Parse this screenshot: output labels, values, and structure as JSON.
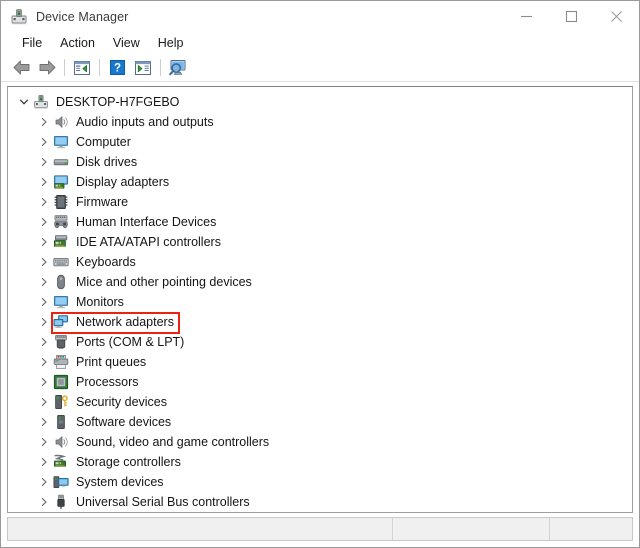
{
  "window": {
    "title": "Device Manager",
    "icon": "device-manager-icon",
    "controls": {
      "minimize": "Minimize",
      "maximize": "Maximize",
      "close": "Close"
    }
  },
  "menubar": {
    "items": [
      {
        "label": "File"
      },
      {
        "label": "Action"
      },
      {
        "label": "View"
      },
      {
        "label": "Help"
      }
    ]
  },
  "toolbar": {
    "buttons": [
      {
        "name": "back-arrow-icon",
        "tooltip": "Back"
      },
      {
        "name": "forward-arrow-icon",
        "tooltip": "Forward"
      },
      {
        "name": "show-hide-console-tree-icon",
        "tooltip": "Show/Hide Console Tree"
      },
      {
        "name": "help-icon",
        "tooltip": "Help"
      },
      {
        "name": "properties-icon",
        "tooltip": "Properties"
      },
      {
        "name": "scan-for-hardware-changes-icon",
        "tooltip": "Scan for hardware changes"
      }
    ]
  },
  "tree": {
    "root": {
      "label": "DESKTOP-H7FGEBO",
      "icon": "computer-device-icon",
      "expanded": true
    },
    "items": [
      {
        "label": "Audio inputs and outputs",
        "icon": "speaker-icon",
        "expanded": false,
        "highlighted": false
      },
      {
        "label": "Computer",
        "icon": "monitor-icon",
        "expanded": false,
        "highlighted": false
      },
      {
        "label": "Disk drives",
        "icon": "disk-drive-icon",
        "expanded": false,
        "highlighted": false
      },
      {
        "label": "Display adapters",
        "icon": "display-adapter-icon",
        "expanded": false,
        "highlighted": false
      },
      {
        "label": "Firmware",
        "icon": "firmware-chip-icon",
        "expanded": false,
        "highlighted": false
      },
      {
        "label": "Human Interface Devices",
        "icon": "gamepad-icon",
        "expanded": false,
        "highlighted": false
      },
      {
        "label": "IDE ATA/ATAPI controllers",
        "icon": "ide-controller-icon",
        "expanded": false,
        "highlighted": false
      },
      {
        "label": "Keyboards",
        "icon": "keyboard-icon",
        "expanded": false,
        "highlighted": false
      },
      {
        "label": "Mice and other pointing devices",
        "icon": "mouse-icon",
        "expanded": false,
        "highlighted": false
      },
      {
        "label": "Monitors",
        "icon": "monitor-icon",
        "expanded": false,
        "highlighted": false
      },
      {
        "label": "Network adapters",
        "icon": "network-adapter-icon",
        "expanded": false,
        "highlighted": true
      },
      {
        "label": "Ports (COM & LPT)",
        "icon": "port-connector-icon",
        "expanded": false,
        "highlighted": false
      },
      {
        "label": "Print queues",
        "icon": "printer-icon",
        "expanded": false,
        "highlighted": false
      },
      {
        "label": "Processors",
        "icon": "processor-chip-icon",
        "expanded": false,
        "highlighted": false
      },
      {
        "label": "Security devices",
        "icon": "security-key-icon",
        "expanded": false,
        "highlighted": false
      },
      {
        "label": "Software devices",
        "icon": "software-device-icon",
        "expanded": false,
        "highlighted": false
      },
      {
        "label": "Sound, video and game controllers",
        "icon": "speaker-icon",
        "expanded": false,
        "highlighted": false
      },
      {
        "label": "Storage controllers",
        "icon": "storage-controller-icon",
        "expanded": false,
        "highlighted": false
      },
      {
        "label": "System devices",
        "icon": "system-device-icon",
        "expanded": false,
        "highlighted": false
      },
      {
        "label": "Universal Serial Bus controllers",
        "icon": "usb-icon",
        "expanded": false,
        "highlighted": false
      }
    ]
  },
  "highlight": {
    "color": "#ee2211",
    "target": "Network adapters"
  },
  "statusbar": {
    "pane1": "",
    "pane2": "",
    "pane3": ""
  }
}
